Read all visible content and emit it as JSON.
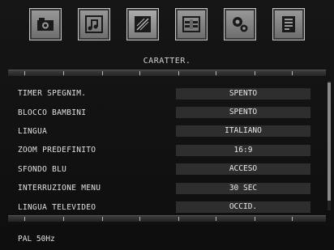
{
  "icons": [
    {
      "name": "camera-icon"
    },
    {
      "name": "music-note-icon"
    },
    {
      "name": "picture-settings-icon"
    },
    {
      "name": "connections-icon"
    },
    {
      "name": "gears-icon"
    },
    {
      "name": "document-icon"
    }
  ],
  "menu": {
    "title": "CARATTER.",
    "items": [
      {
        "label": "TIMER SPEGNIM.",
        "value": "SPENTO"
      },
      {
        "label": "BLOCCO BAMBINI",
        "value": "SPENTO"
      },
      {
        "label": "LINGUA",
        "value": "ITALIANO"
      },
      {
        "label": "ZOOM PREDEFINITO",
        "value": "16:9"
      },
      {
        "label": "SFONDO BLU",
        "value": "ACCESO"
      },
      {
        "label": "INTERRUZIONE MENU",
        "value": "30 SEC"
      },
      {
        "label": "LINGUA TELEVIDEO",
        "value": "OCCID."
      }
    ]
  },
  "status": {
    "signal": "PAL 50Hz"
  },
  "colors": {
    "background": "#121212",
    "value_box": "#2e2e2e",
    "icon_face": "#8a8a8a"
  }
}
